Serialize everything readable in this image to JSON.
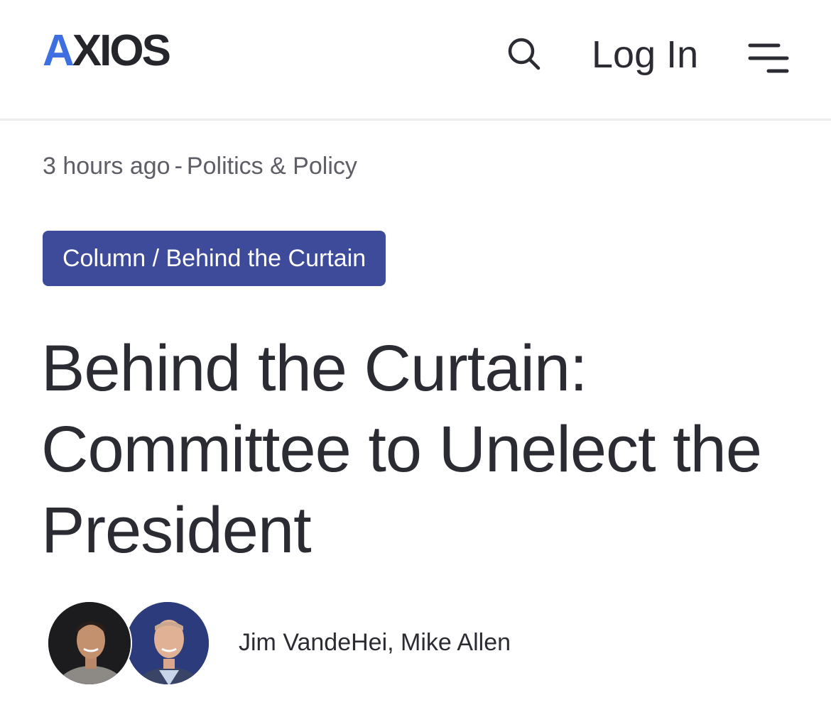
{
  "header": {
    "logo_text": "AXIOS",
    "login_label": "Log In",
    "search_icon": "search-icon",
    "menu_icon": "menu-icon",
    "accent_color": "#3d6fe0"
  },
  "article": {
    "timestamp": "3 hours ago",
    "separator": "-",
    "category": "Politics & Policy",
    "tag": "Column / Behind the Curtain",
    "tag_color": "#3d4b9a",
    "headline": "Behind the Curtain: Committee to Unelect the President",
    "authors": [
      "Jim VandeHei",
      "Mike Allen"
    ],
    "authors_joiner": ", "
  }
}
